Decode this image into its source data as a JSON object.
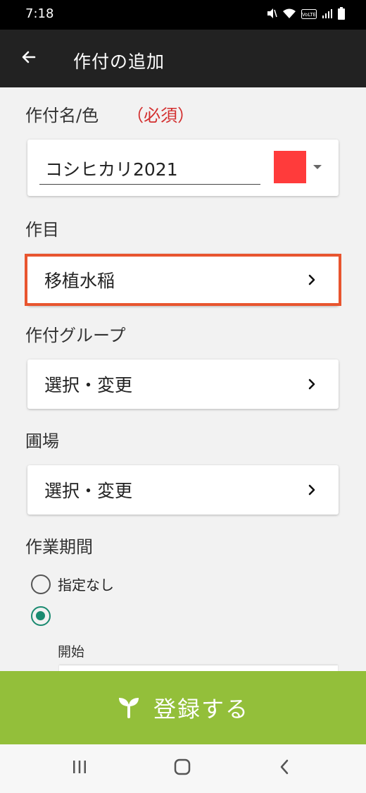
{
  "status_bar": {
    "time": "7:18",
    "icons": [
      "mute-icon",
      "wifi-icon",
      "volte-icon",
      "signal-icon",
      "battery-icon"
    ],
    "volte_text": "VoLTE"
  },
  "app_bar": {
    "title": "作付の追加",
    "back_icon": "arrow-back-icon"
  },
  "form": {
    "name_color": {
      "label": "作付名/色",
      "required": "（必須）",
      "value": "コシヒカリ2021",
      "color": "#ff3b3b"
    },
    "crop": {
      "label": "作目",
      "value": "移植水稲"
    },
    "crop_group": {
      "label": "作付グループ",
      "value": "選択・変更"
    },
    "field": {
      "label": "圃場",
      "value": "選択・変更"
    },
    "work_period": {
      "label": "作業期間",
      "options": [
        {
          "label": "指定なし",
          "selected": false
        },
        {
          "label": "",
          "selected": true
        }
      ],
      "start_label": "開始"
    }
  },
  "register_button": {
    "label": "登録する",
    "icon": "sprout-icon",
    "color": "#93bf3a"
  },
  "nav_bar": {
    "buttons": [
      "recent-apps-icon",
      "home-icon",
      "back-icon"
    ]
  },
  "colors": {
    "accent": "#1a8a70",
    "highlight": "#e8552f",
    "required": "#d32f2f",
    "app_bar": "#222222"
  }
}
